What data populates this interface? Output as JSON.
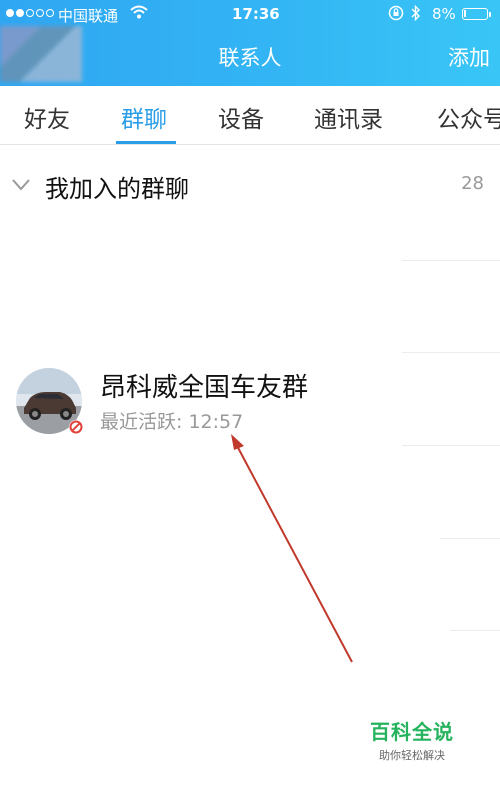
{
  "status_bar": {
    "carrier": "中国联通",
    "time": "17:36",
    "battery_pct": "8%",
    "battery_level": 0.08
  },
  "header": {
    "title": "联系人",
    "add_label": "添加",
    "gradient_colors": [
      "#2fa6f2",
      "#39c6f6"
    ]
  },
  "tabs": [
    {
      "label": "好友",
      "active": false
    },
    {
      "label": "群聊",
      "active": true
    },
    {
      "label": "设备",
      "active": false
    },
    {
      "label": "通讯录",
      "active": false
    },
    {
      "label": "公众号",
      "active": false
    }
  ],
  "accent_color": "#2a9de8",
  "group": {
    "title": "我加入的群聊",
    "count": "28"
  },
  "groups": [
    {
      "name": "昂科威全国车友群",
      "last_active": "最近活跃: 12:57",
      "avatar_icon": "car-photo",
      "badge_icon": "no-disturb-icon"
    }
  ],
  "watermark": {
    "main": "百科全说",
    "sub": "助你轻松解决"
  }
}
